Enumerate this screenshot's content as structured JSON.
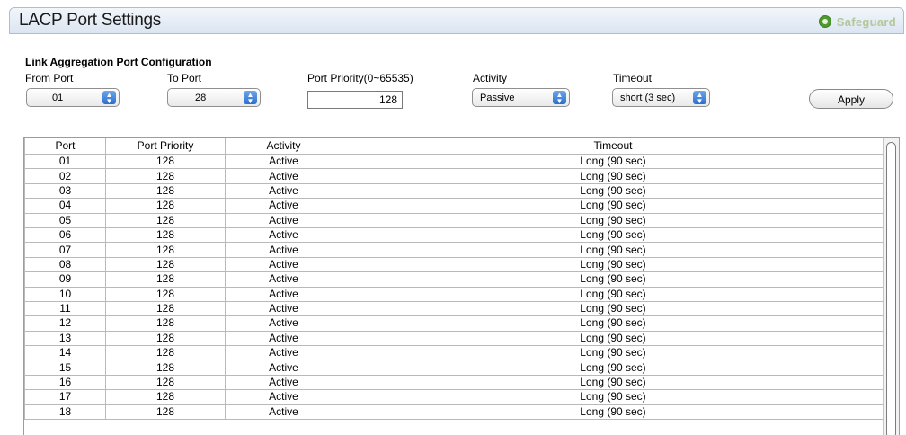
{
  "window": {
    "title": "LACP Port Settings",
    "brand": "Safeguard",
    "brand_color": "#4e9a2f"
  },
  "config": {
    "section_title": "Link Aggregation Port Configuration",
    "from_port": {
      "label": "From Port",
      "value": "01"
    },
    "to_port": {
      "label": "To Port",
      "value": "28"
    },
    "port_priority": {
      "label": "Port Priority(0~65535)",
      "value": "128"
    },
    "activity": {
      "label": "Activity",
      "value": "Passive"
    },
    "timeout": {
      "label": "Timeout",
      "value": "short (3 sec)"
    },
    "apply_label": "Apply"
  },
  "table": {
    "headers": [
      "Port",
      "Port Priority",
      "Activity",
      "Timeout"
    ],
    "rows": [
      [
        "01",
        "128",
        "Active",
        "Long (90 sec)"
      ],
      [
        "02",
        "128",
        "Active",
        "Long (90 sec)"
      ],
      [
        "03",
        "128",
        "Active",
        "Long (90 sec)"
      ],
      [
        "04",
        "128",
        "Active",
        "Long (90 sec)"
      ],
      [
        "05",
        "128",
        "Active",
        "Long (90 sec)"
      ],
      [
        "06",
        "128",
        "Active",
        "Long (90 sec)"
      ],
      [
        "07",
        "128",
        "Active",
        "Long (90 sec)"
      ],
      [
        "08",
        "128",
        "Active",
        "Long (90 sec)"
      ],
      [
        "09",
        "128",
        "Active",
        "Long (90 sec)"
      ],
      [
        "10",
        "128",
        "Active",
        "Long (90 sec)"
      ],
      [
        "11",
        "128",
        "Active",
        "Long (90 sec)"
      ],
      [
        "12",
        "128",
        "Active",
        "Long (90 sec)"
      ],
      [
        "13",
        "128",
        "Active",
        "Long (90 sec)"
      ],
      [
        "14",
        "128",
        "Active",
        "Long (90 sec)"
      ],
      [
        "15",
        "128",
        "Active",
        "Long (90 sec)"
      ],
      [
        "16",
        "128",
        "Active",
        "Long (90 sec)"
      ],
      [
        "17",
        "128",
        "Active",
        "Long (90 sec)"
      ],
      [
        "18",
        "128",
        "Active",
        "Long (90 sec)"
      ]
    ]
  }
}
